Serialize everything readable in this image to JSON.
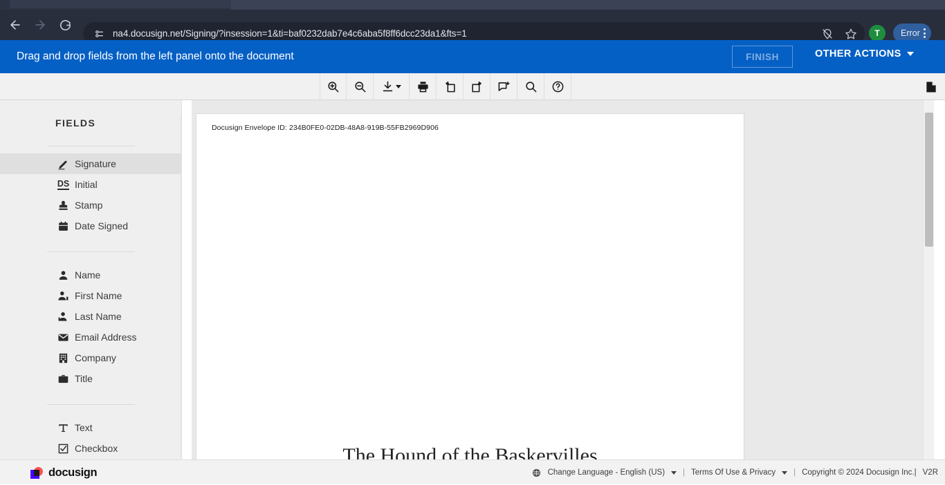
{
  "browser": {
    "url": "na4.docusign.net/Signing/?insession=1&ti=baf0232dab7e4c6aba5f8ff6dcc23da1&fts=1",
    "back_label": "Back",
    "forward_label": "Forward",
    "reload_label": "Reload",
    "site_info_label": "View site information",
    "location_blocked_label": "Location blocked",
    "bookmark_label": "Bookmark this tab",
    "avatar_initial": "T",
    "profile_status": "Error",
    "menu_label": "Customize and control Chrome"
  },
  "banner": {
    "instruction": "Drag and drop fields from the left panel onto the document",
    "finish_label": "FINISH",
    "other_actions_label": "OTHER ACTIONS"
  },
  "toolbar": {
    "buttons": [
      {
        "name": "zoom-in-icon",
        "label": "Zoom In"
      },
      {
        "name": "zoom-out-icon",
        "label": "Zoom Out"
      },
      {
        "name": "download-icon",
        "label": "Download"
      },
      {
        "name": "print-icon",
        "label": "Print"
      },
      {
        "name": "rotate-left-icon",
        "label": "Rotate Left"
      },
      {
        "name": "rotate-right-icon",
        "label": "Rotate Right"
      },
      {
        "name": "add-comment-icon",
        "label": "Add Comment"
      },
      {
        "name": "search-icon",
        "label": "Search"
      },
      {
        "name": "help-icon",
        "label": "Help"
      }
    ],
    "page-thumbnails_label": "Page Thumbnails"
  },
  "sidebar": {
    "title": "FIELDS",
    "groups": [
      {
        "items": [
          {
            "label": "Signature",
            "icon": "signature-pen-icon",
            "selected": true
          },
          {
            "label": "Initial",
            "icon": "initial-ds-icon",
            "selected": false
          },
          {
            "label": "Stamp",
            "icon": "stamp-icon",
            "selected": false
          },
          {
            "label": "Date Signed",
            "icon": "calendar-icon",
            "selected": false
          }
        ]
      },
      {
        "items": [
          {
            "label": "Name",
            "icon": "person-icon",
            "selected": false
          },
          {
            "label": "First Name",
            "icon": "person-first-icon",
            "selected": false
          },
          {
            "label": "Last Name",
            "icon": "person-last-icon",
            "selected": false
          },
          {
            "label": "Email Address",
            "icon": "envelope-icon",
            "selected": false
          },
          {
            "label": "Company",
            "icon": "building-icon",
            "selected": false
          },
          {
            "label": "Title",
            "icon": "briefcase-icon",
            "selected": false
          }
        ]
      },
      {
        "items": [
          {
            "label": "Text",
            "icon": "text-t-icon",
            "selected": false
          },
          {
            "label": "Checkbox",
            "icon": "checkbox-icon",
            "selected": false
          }
        ]
      }
    ]
  },
  "document": {
    "envelope_id": "Docusign Envelope ID: 234B0FE0-02DB-48A8-919B-55FB2969D906",
    "heading": "The Hound of the Baskervilles"
  },
  "footer": {
    "brand": "docusign",
    "language": "Change Language - English (US)",
    "terms": "Terms Of Use & Privacy",
    "copyright": "Copyright © 2024 Docusign Inc.|",
    "version": "V2R",
    "separator": "|"
  }
}
